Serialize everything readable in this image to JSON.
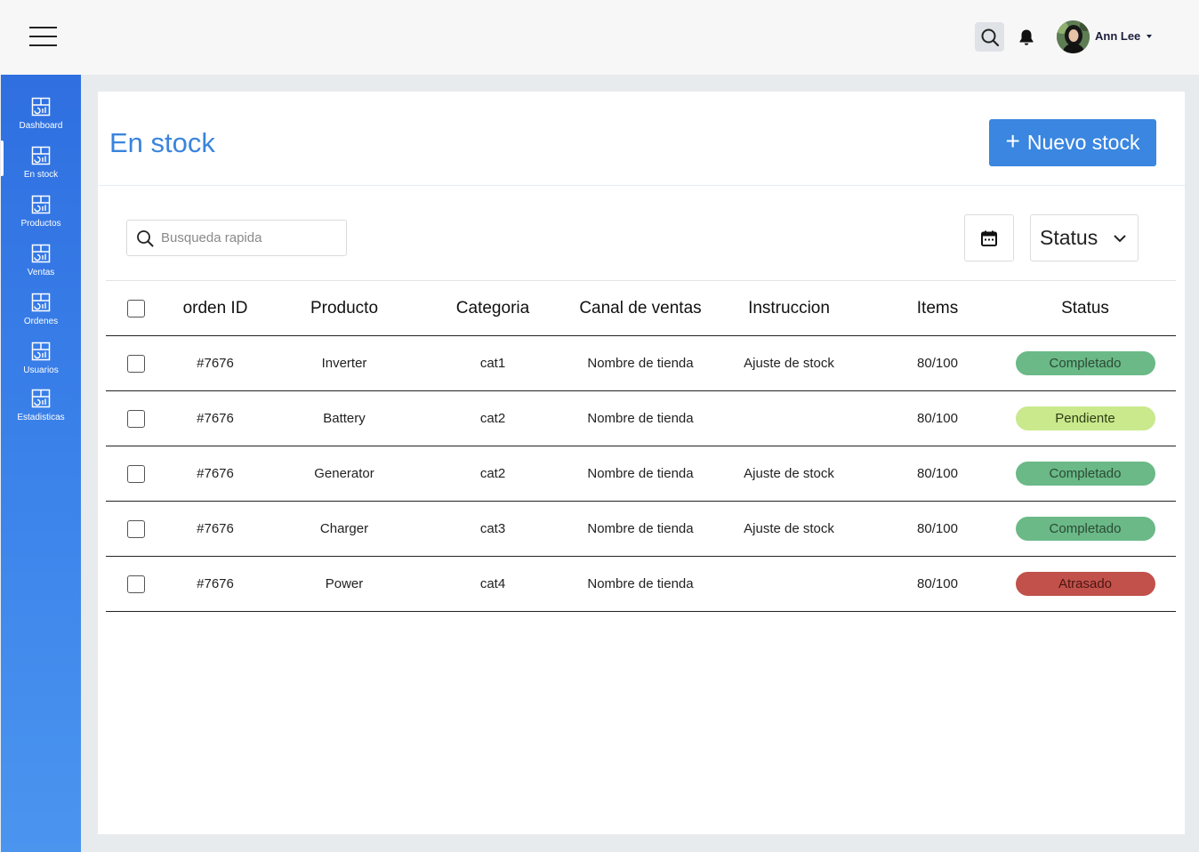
{
  "header": {
    "user_name": "Ann Lee"
  },
  "sidebar": {
    "items": [
      {
        "label": "Dashboard",
        "icon": "dashboard-icon"
      },
      {
        "label": "En stock",
        "icon": "stock-icon"
      },
      {
        "label": "Productos",
        "icon": "products-icon"
      },
      {
        "label": "Ventas",
        "icon": "sales-icon"
      },
      {
        "label": "Ordenes",
        "icon": "orders-icon"
      },
      {
        "label": "Usuarios",
        "icon": "users-icon"
      },
      {
        "label": "Estadisticas",
        "icon": "stats-icon"
      }
    ],
    "active_index": 1
  },
  "main": {
    "title": "En stock",
    "new_button_label": "Nuevo stock",
    "search_placeholder": "Busqueda rapida",
    "status_filter_label": "Status"
  },
  "table": {
    "headers": [
      "orden ID",
      "Producto",
      "Categoria",
      "Canal de ventas",
      "Instruccion",
      "Items",
      "Status"
    ],
    "rows": [
      {
        "order_id": "#7676",
        "product": "Inverter",
        "category": "cat1",
        "channel": "Nombre de tienda",
        "instruction": "Ajuste de stock",
        "items": "80/100",
        "status": "Completado",
        "status_type": "done"
      },
      {
        "order_id": "#7676",
        "product": "Battery",
        "category": "cat2",
        "channel": "Nombre de tienda",
        "instruction": "",
        "items": "80/100",
        "status": "Pendiente",
        "status_type": "pending"
      },
      {
        "order_id": "#7676",
        "product": "Generator",
        "category": "cat2",
        "channel": "Nombre de tienda",
        "instruction": "Ajuste de stock",
        "items": "80/100",
        "status": "Completado",
        "status_type": "done"
      },
      {
        "order_id": "#7676",
        "product": "Charger",
        "category": "cat3",
        "channel": "Nombre de tienda",
        "instruction": "Ajuste de stock",
        "items": "80/100",
        "status": "Completado",
        "status_type": "done"
      },
      {
        "order_id": "#7676",
        "product": "Power",
        "category": "cat4",
        "channel": "Nombre de tienda",
        "instruction": "",
        "items": "80/100",
        "status": "Atrasado",
        "status_type": "late"
      }
    ]
  },
  "colors": {
    "accent": "#3a86e0",
    "title": "#3a84dd",
    "status_done": "#6ab987",
    "status_pending": "#c9e98c",
    "status_late": "#c1514a"
  }
}
